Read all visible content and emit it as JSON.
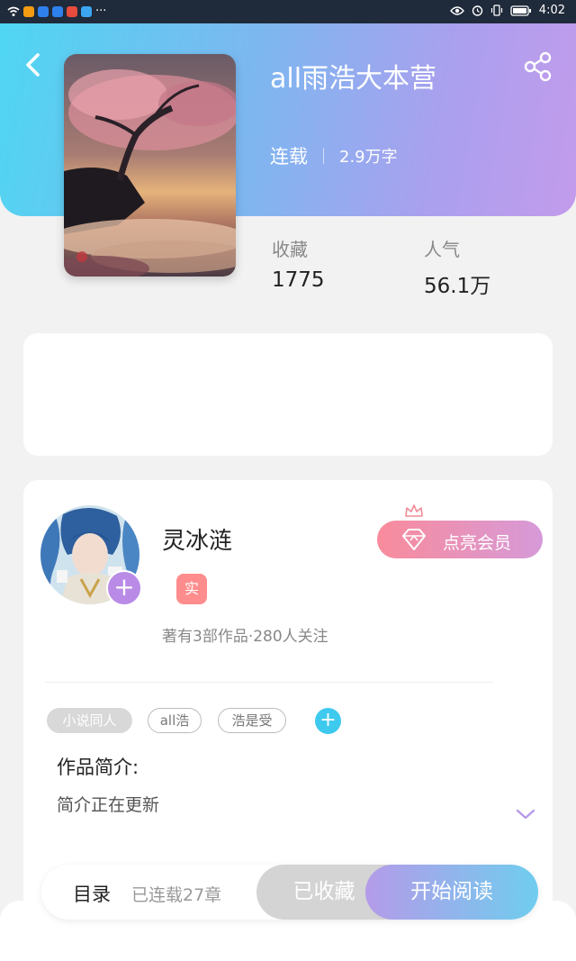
{
  "status_bar": {
    "more": "···",
    "time": "4:02",
    "app_icon_colors": [
      "#f39c12",
      "#2f80ed",
      "#2f80ed",
      "#e74c3c",
      "#3ca6f0"
    ]
  },
  "book": {
    "title": "all雨浩大本营",
    "status": "连载",
    "word_count": "2.9万字"
  },
  "stats": {
    "favorites_label": "收藏",
    "favorites_value": "1775",
    "popularity_label": "人气",
    "popularity_value": "56.1万"
  },
  "author": {
    "name": "灵冰涟",
    "badge": "实",
    "follow_symbol": "+",
    "stats": "著有3部作品·280人关注",
    "vip_label": "点亮会员"
  },
  "tags": [
    {
      "label": "小说同人"
    },
    {
      "label": "all浩"
    },
    {
      "label": "浩是受"
    }
  ],
  "add_tag_symbol": "+",
  "intro": {
    "heading": "作品简介:",
    "text": "简介正在更新"
  },
  "action_bar": {
    "toc_label": "目录",
    "chapters": "已连载27章",
    "favorite_label": "已收藏",
    "read_label": "开始阅读"
  },
  "colors": {
    "header_gradient_start": "#4fd6f2",
    "header_gradient_end": "#c39bec",
    "vip_pink": "#f98b9b",
    "accent_cyan": "#3ec9ee",
    "accent_purple": "#b98be6"
  },
  "icons": {
    "back": "back-icon",
    "share": "share-icon",
    "diamond": "diamond-icon",
    "crown": "crown-icon",
    "expand": "chevron-down-icon"
  }
}
